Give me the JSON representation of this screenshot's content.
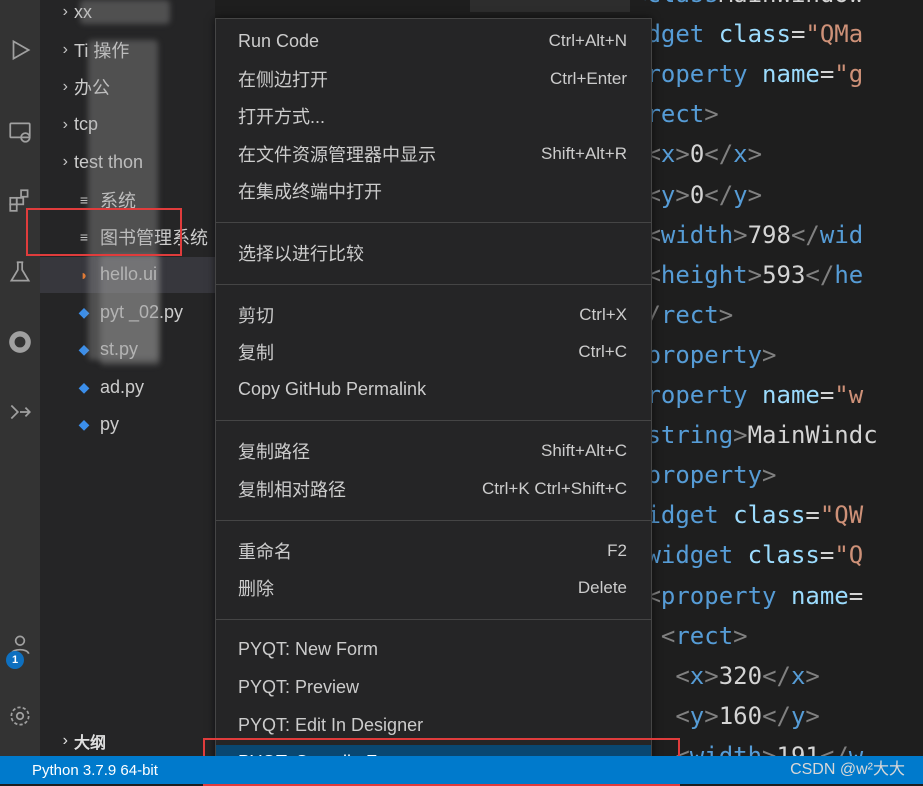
{
  "sidebar": {
    "rows": [
      {
        "label": "xx",
        "icon": "chevron-right-icon"
      },
      {
        "label": "Ti 操作",
        "icon": "chevron-right-icon"
      },
      {
        "label": "办公",
        "icon": "chevron-right-icon"
      },
      {
        "label": "tcp",
        "icon": "chevron-right-icon"
      },
      {
        "label": "test thon",
        "icon": "chevron-right-icon"
      },
      {
        "label": "系统",
        "icon": "file-icon"
      },
      {
        "label": "图书管理系统",
        "icon": "list-icon"
      },
      {
        "label": "hello.ui",
        "icon": "rss-icon"
      },
      {
        "label": "pyt _02.py",
        "icon": "python-icon"
      },
      {
        "label": "st.py",
        "icon": "python-icon"
      },
      {
        "label": "ad.py",
        "icon": "python-icon"
      },
      {
        "label": "py",
        "icon": "python-icon"
      }
    ],
    "outline_label": "大纲"
  },
  "activity": {
    "badge_count": "1"
  },
  "menu": {
    "groups": [
      [
        {
          "label": "Run Code",
          "shortcut": "Ctrl+Alt+N"
        },
        {
          "label": "在侧边打开",
          "shortcut": "Ctrl+Enter"
        },
        {
          "label": "打开方式...",
          "shortcut": ""
        },
        {
          "label": "在文件资源管理器中显示",
          "shortcut": "Shift+Alt+R"
        },
        {
          "label": "在集成终端中打开",
          "shortcut": ""
        }
      ],
      [
        {
          "label": "选择以进行比较",
          "shortcut": ""
        }
      ],
      [
        {
          "label": "剪切",
          "shortcut": "Ctrl+X"
        },
        {
          "label": "复制",
          "shortcut": "Ctrl+C"
        },
        {
          "label": "Copy GitHub Permalink",
          "shortcut": ""
        }
      ],
      [
        {
          "label": "复制路径",
          "shortcut": "Shift+Alt+C"
        },
        {
          "label": "复制相对路径",
          "shortcut": "Ctrl+K Ctrl+Shift+C"
        }
      ],
      [
        {
          "label": "重命名",
          "shortcut": "F2"
        },
        {
          "label": "删除",
          "shortcut": "Delete"
        }
      ],
      [
        {
          "label": "PYQT: New Form",
          "shortcut": ""
        },
        {
          "label": "PYQT: Preview",
          "shortcut": ""
        },
        {
          "label": "PYQT: Edit In Designer",
          "shortcut": ""
        },
        {
          "label": "PYQT: Compile Form",
          "shortcut": ""
        }
      ]
    ]
  },
  "editor": {
    "lines": [
      [
        [
          "tag",
          "<"
        ],
        [
          "tag",
          "class"
        ],
        [
          "txt",
          "MainWindow"
        ]
      ],
      [
        [
          "tag",
          "idget "
        ],
        [
          "attr",
          "class"
        ],
        [
          "txt",
          "="
        ],
        [
          "str",
          "\"QMa"
        ]
      ],
      [
        [
          "tag",
          "property "
        ],
        [
          "attr",
          "name"
        ],
        [
          "txt",
          "="
        ],
        [
          "str",
          "\"g"
        ]
      ],
      [
        [
          "br",
          "<"
        ],
        [
          "tag",
          "rect"
        ],
        [
          "br",
          ">"
        ]
      ],
      [
        [
          "br",
          " <"
        ],
        [
          "tag",
          "x"
        ],
        [
          "br",
          ">"
        ],
        [
          "txt",
          "0"
        ],
        [
          "br",
          "</"
        ],
        [
          "tag",
          "x"
        ],
        [
          "br",
          ">"
        ]
      ],
      [
        [
          "br",
          " <"
        ],
        [
          "tag",
          "y"
        ],
        [
          "br",
          ">"
        ],
        [
          "txt",
          "0"
        ],
        [
          "br",
          "</"
        ],
        [
          "tag",
          "y"
        ],
        [
          "br",
          ">"
        ]
      ],
      [
        [
          "br",
          " <"
        ],
        [
          "tag",
          "width"
        ],
        [
          "br",
          ">"
        ],
        [
          "txt",
          "798"
        ],
        [
          "br",
          "</"
        ],
        [
          "tag",
          "wid"
        ]
      ],
      [
        [
          "br",
          " <"
        ],
        [
          "tag",
          "height"
        ],
        [
          "br",
          ">"
        ],
        [
          "txt",
          "593"
        ],
        [
          "br",
          "</"
        ],
        [
          "tag",
          "he"
        ]
      ],
      [
        [
          "br",
          "</"
        ],
        [
          "tag",
          "rect"
        ],
        [
          "br",
          ">"
        ]
      ],
      [
        [
          "tag",
          "/property"
        ],
        [
          "br",
          ">"
        ]
      ],
      [
        [
          "tag",
          "property "
        ],
        [
          "attr",
          "name"
        ],
        [
          "txt",
          "="
        ],
        [
          "str",
          "\"w"
        ]
      ],
      [
        [
          "br",
          "<"
        ],
        [
          "tag",
          "string"
        ],
        [
          "br",
          ">"
        ],
        [
          "txt",
          "MainWindc"
        ]
      ],
      [
        [
          "tag",
          "/property"
        ],
        [
          "br",
          ">"
        ]
      ],
      [
        [
          "tag",
          "widget "
        ],
        [
          "attr",
          "class"
        ],
        [
          "txt",
          "="
        ],
        [
          "str",
          "\"QW"
        ]
      ],
      [
        [
          "br",
          "<"
        ],
        [
          "tag",
          "widget "
        ],
        [
          "attr",
          "class"
        ],
        [
          "txt",
          "="
        ],
        [
          "str",
          "\"Q"
        ]
      ],
      [
        [
          "br",
          " <"
        ],
        [
          "tag",
          "property "
        ],
        [
          "attr",
          "name"
        ],
        [
          "txt",
          "="
        ]
      ],
      [
        [
          "br",
          "  <"
        ],
        [
          "tag",
          "rect"
        ],
        [
          "br",
          ">"
        ]
      ],
      [
        [
          "br",
          "   <"
        ],
        [
          "tag",
          "x"
        ],
        [
          "br",
          ">"
        ],
        [
          "txt",
          "320"
        ],
        [
          "br",
          "</"
        ],
        [
          "tag",
          "x"
        ],
        [
          "br",
          ">"
        ]
      ],
      [
        [
          "br",
          "   <"
        ],
        [
          "tag",
          "y"
        ],
        [
          "br",
          ">"
        ],
        [
          "txt",
          "160"
        ],
        [
          "br",
          "</"
        ],
        [
          "tag",
          "y"
        ],
        [
          "br",
          ">"
        ]
      ],
      [
        [
          "br",
          "   <"
        ],
        [
          "tag",
          "width"
        ],
        [
          "br",
          ">"
        ],
        [
          "txt",
          "191"
        ],
        [
          "br",
          "</"
        ],
        [
          "tag",
          "w"
        ]
      ]
    ]
  },
  "status": {
    "python": "Python 3.7.9 64-bit",
    "watermark": "CSDN @w²大大"
  },
  "colors": {
    "accent": "#007acc",
    "menu_active": "#094771",
    "highlight": "#e03c3c"
  }
}
